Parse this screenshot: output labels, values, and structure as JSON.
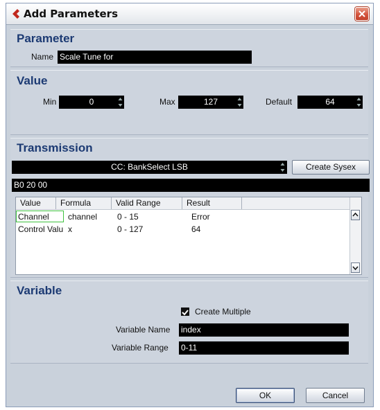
{
  "window": {
    "title": "Add Parameters"
  },
  "parameter": {
    "heading": "Parameter",
    "name_label": "Name",
    "name_value": "Scale Tune for"
  },
  "value": {
    "heading": "Value",
    "min_label": "Min",
    "min_value": "0",
    "max_label": "Max",
    "max_value": "127",
    "default_label": "Default",
    "default_value": "64"
  },
  "transmission": {
    "heading": "Transmission",
    "message_type": "CC: BankSelect LSB",
    "create_sysex_label": "Create Sysex",
    "hex_value": "B0 20 00",
    "columns": [
      "Value",
      "Formula",
      "Valid Range",
      "Result"
    ],
    "rows": [
      {
        "value": "Channel",
        "formula": "channel",
        "range": "0 - 15",
        "result": "Error"
      },
      {
        "value": "Control Valu",
        "formula": "x",
        "range": "0 - 127",
        "result": "64"
      }
    ]
  },
  "variable": {
    "heading": "Variable",
    "create_multiple_label": "Create Multiple",
    "create_multiple_checked": true,
    "name_label": "Variable Name",
    "name_value": "index",
    "range_label": "Variable Range",
    "range_value": "0-11"
  },
  "footer": {
    "ok_label": "OK",
    "cancel_label": "Cancel"
  }
}
